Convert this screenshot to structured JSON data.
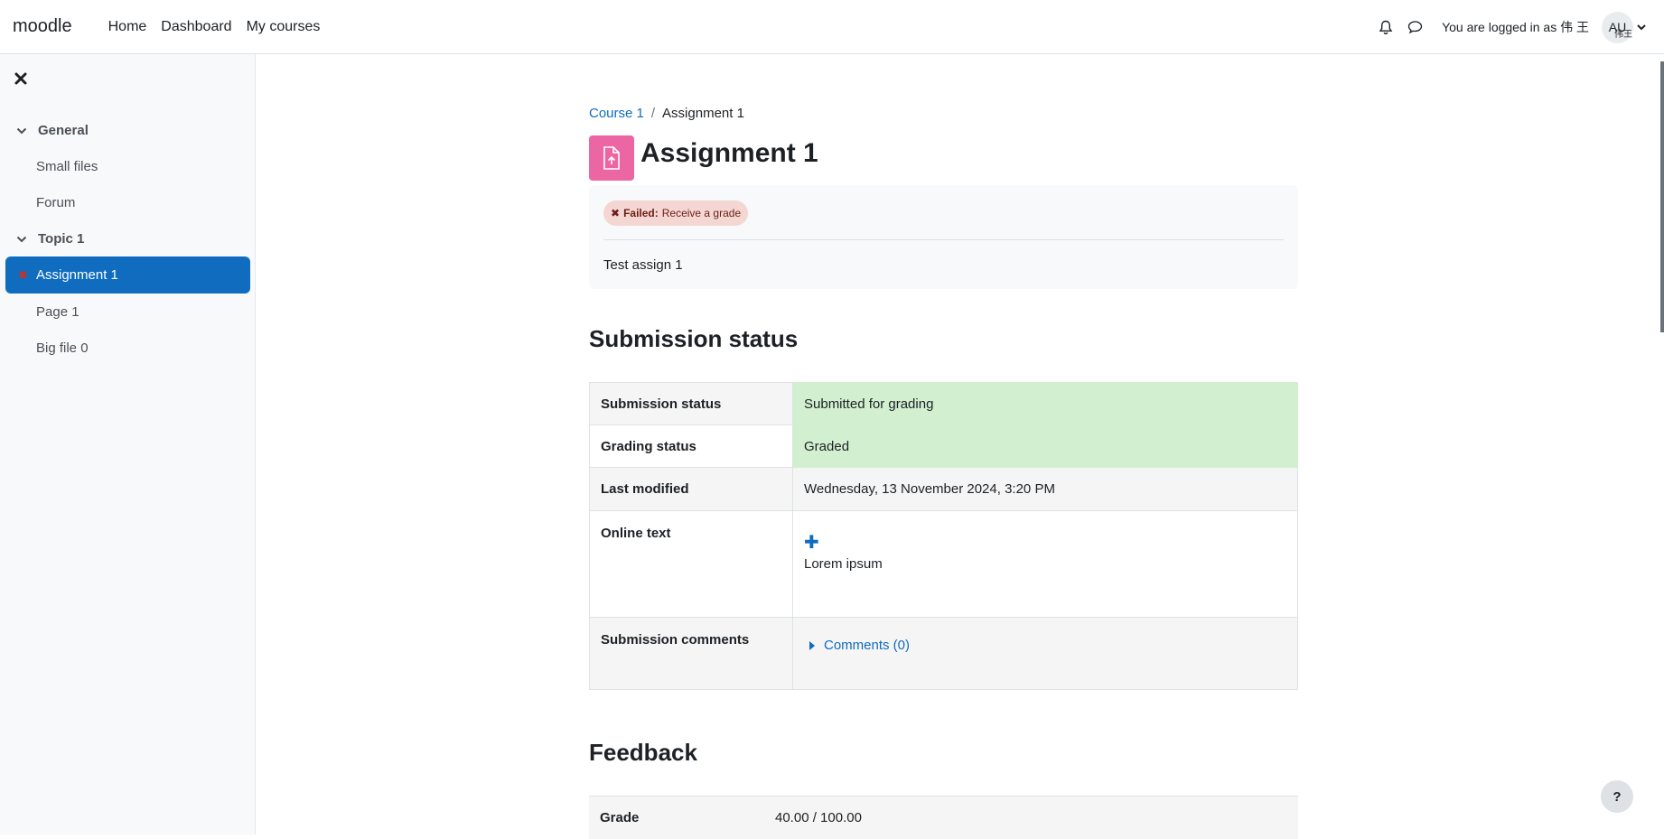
{
  "navbar": {
    "brand": "moodle",
    "links": [
      "Home",
      "Dashboard",
      "My courses"
    ],
    "logged_in_text": "You are logged in as 伟 王",
    "avatar_initials": "AU",
    "avatar_subtext": "伟王"
  },
  "drawer": {
    "sections": [
      {
        "label": "General",
        "items": [
          "Small files",
          "Forum"
        ]
      },
      {
        "label": "Topic 1",
        "items": [
          "Assignment 1",
          "Page 1",
          "Big file 0"
        ]
      }
    ],
    "active_item": "Assignment 1"
  },
  "breadcrumb": {
    "course": "Course 1",
    "separator": "/",
    "current": "Assignment 1"
  },
  "page": {
    "title": "Assignment 1",
    "badge_status": "Failed:",
    "badge_text": "Receive a grade",
    "description": "Test assign 1"
  },
  "submission": {
    "heading": "Submission status",
    "rows": [
      {
        "label": "Submission status",
        "value": "Submitted for grading"
      },
      {
        "label": "Grading status",
        "value": "Graded"
      },
      {
        "label": "Last modified",
        "value": "Wednesday, 13 November 2024, 3:20 PM"
      },
      {
        "label": "Online text",
        "value": "Lorem ipsum"
      },
      {
        "label": "Submission comments",
        "value": "Comments (0)"
      }
    ]
  },
  "feedback": {
    "heading": "Feedback",
    "grade_label": "Grade",
    "grade_value": "40.00 / 100.00"
  },
  "help_label": "?",
  "colors": {
    "primary": "#0f6cbf",
    "assign_icon": "#eb66a2",
    "success_bg": "#d2efd0",
    "failed_badge": "#f4d6d2"
  }
}
